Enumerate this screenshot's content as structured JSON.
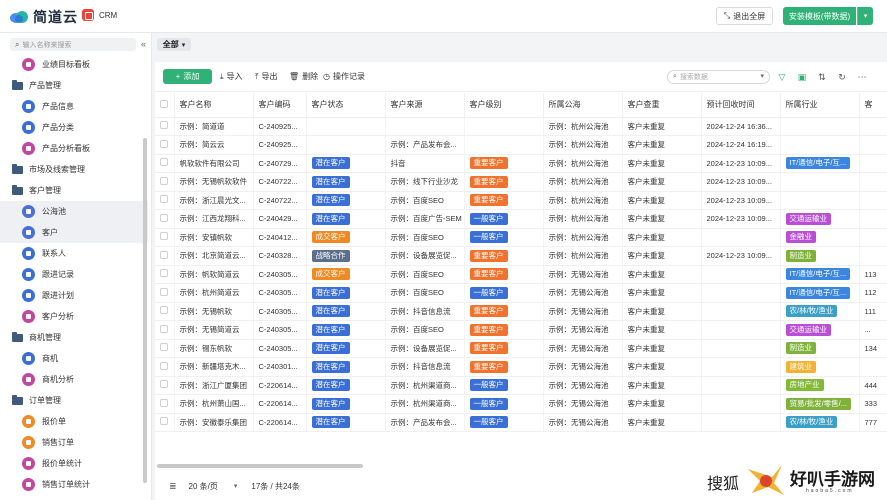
{
  "header": {
    "brand": "简道云",
    "app_name": "CRM",
    "exit_fullscreen": "退出全屏",
    "install_template": "安装模板(带数据)"
  },
  "sidebar": {
    "search_placeholder": "输入名称来搜索",
    "collapse": "«",
    "items": [
      {
        "type": "leaf",
        "label": "业绩目标看板",
        "icon": "dashboard-icon",
        "color": "#c1489e"
      },
      {
        "type": "group",
        "label": "产品管理"
      },
      {
        "type": "leaf",
        "label": "产品信息",
        "icon": "form-icon",
        "color": "#3b6fd6"
      },
      {
        "type": "leaf",
        "label": "产品分类",
        "icon": "form-icon",
        "color": "#3b6fd6"
      },
      {
        "type": "leaf",
        "label": "产品分析看板",
        "icon": "dashboard-icon",
        "color": "#c1489e"
      },
      {
        "type": "group",
        "label": "市场及线索管理"
      },
      {
        "type": "group",
        "label": "客户管理"
      },
      {
        "type": "leaf",
        "label": "公海池",
        "icon": "user-icon",
        "color": "#4a6fd8",
        "active": true
      },
      {
        "type": "leaf",
        "label": "客户",
        "icon": "user-icon",
        "color": "#4a6fd8",
        "active": true
      },
      {
        "type": "leaf",
        "label": "联系人",
        "icon": "form-icon",
        "color": "#3b6fd6"
      },
      {
        "type": "leaf",
        "label": "跟进记录",
        "icon": "form-icon",
        "color": "#3b6fd6"
      },
      {
        "type": "leaf",
        "label": "跟进计划",
        "icon": "form-icon",
        "color": "#3b6fd6"
      },
      {
        "type": "leaf",
        "label": "客户分析",
        "icon": "dashboard-icon",
        "color": "#c1489e"
      },
      {
        "type": "group",
        "label": "商机管理"
      },
      {
        "type": "leaf",
        "label": "商机",
        "icon": "opportunity-icon",
        "color": "#3b6fd6"
      },
      {
        "type": "leaf",
        "label": "商机分析",
        "icon": "dashboard-icon",
        "color": "#c1489e"
      },
      {
        "type": "group",
        "label": "订单管理"
      },
      {
        "type": "leaf",
        "label": "报价单",
        "icon": "quote-icon",
        "color": "#f08a24"
      },
      {
        "type": "leaf",
        "label": "销售订单",
        "icon": "order-icon",
        "color": "#f08a24"
      },
      {
        "type": "leaf",
        "label": "报价单统计",
        "icon": "dashboard-icon",
        "color": "#c1489e"
      },
      {
        "type": "leaf",
        "label": "销售订单统计",
        "icon": "dashboard-icon",
        "color": "#c1489e"
      }
    ]
  },
  "filter": {
    "label": "全部"
  },
  "toolbar": {
    "add": "添加",
    "import": "导入",
    "export": "导出",
    "delete": "删除",
    "op_log": "操作记录",
    "search_placeholder": "搜索数据"
  },
  "table": {
    "columns": [
      "客户名称",
      "客户编码",
      "客户状态",
      "客户来源",
      "客户级别",
      "所属公海",
      "客户查重",
      "预计回收时间",
      "所属行业",
      "客"
    ],
    "rows": [
      {
        "name": "示例：简道道",
        "code": "C-240925...",
        "status": "",
        "source": "",
        "level": "",
        "pool": "示例：杭州公海池",
        "dup": "客户未重复",
        "time": "2024-12-24 16:36...",
        "industry": "",
        "extra": ""
      },
      {
        "name": "示例：简云云",
        "code": "C-240925...",
        "status": "",
        "source": "示例：产品发布会...",
        "level": "",
        "pool": "示例：杭州公海池",
        "dup": "客户未重复",
        "time": "2024-12-24 16:19...",
        "industry": "",
        "extra": ""
      },
      {
        "name": "帆软软件有限公司",
        "code": "C-240729...",
        "status": "潜在客户",
        "source": "抖音",
        "level": "重要客户",
        "pool": "示例：杭州公海池",
        "dup": "客户未重复",
        "time": "2024-12-23 10:09...",
        "industry": "IT/通信/电子/互...",
        "extra": ""
      },
      {
        "name": "示例：无锡帆软软件",
        "code": "C-240722...",
        "status": "潜在客户",
        "source": "示例：线下行业沙龙",
        "level": "重要客户",
        "pool": "示例：杭州公海池",
        "dup": "客户未重复",
        "time": "2024-12-23 10:09...",
        "industry": "",
        "extra": ""
      },
      {
        "name": "示例：浙江晨光文...",
        "code": "C-240722...",
        "status": "潜在客户",
        "source": "示例：百度SEO",
        "level": "重要客户",
        "pool": "示例：杭州公海池",
        "dup": "客户未重复",
        "time": "2024-12-23 10:09...",
        "industry": "",
        "extra": ""
      },
      {
        "name": "示例：江西龙翔科...",
        "code": "C-240429...",
        "status": "潜在客户",
        "source": "示例：百度广告-SEM",
        "level": "一般客户",
        "pool": "示例：杭州公海池",
        "dup": "客户未重复",
        "time": "2024-12-23 10:09...",
        "industry": "交通运输业",
        "extra": ""
      },
      {
        "name": "示例：安镇帆软",
        "code": "C-240412...",
        "status": "成交客户",
        "source": "示例：百度SEO",
        "level": "一般客户",
        "pool": "示例：杭州公海池",
        "dup": "客户未重复",
        "time": "",
        "industry": "金融业",
        "extra": ""
      },
      {
        "name": "示例：北京简道云...",
        "code": "C-240328...",
        "status": "战略合作",
        "source": "示例：设备展览促...",
        "level": "重要客户",
        "pool": "示例：杭州公海池",
        "dup": "客户未重复",
        "time": "2024-12-23 10:09...",
        "industry": "制造业",
        "extra": ""
      },
      {
        "name": "示例：帆软简道云",
        "code": "C-240305...",
        "status": "成交客户",
        "source": "示例：百度SEO",
        "level": "重要客户",
        "pool": "示例：无锡公海池",
        "dup": "客户未重复",
        "time": "",
        "industry": "IT/通信/电子/互...",
        "extra": "113"
      },
      {
        "name": "示例：杭州简道云",
        "code": "C-240305...",
        "status": "潜在客户",
        "source": "示例：百度SEO",
        "level": "一般客户",
        "pool": "示例：无锡公海池",
        "dup": "客户未重复",
        "time": "",
        "industry": "IT/通信/电子/互...",
        "extra": "112"
      },
      {
        "name": "示例：无锡帆软",
        "code": "C-240305...",
        "status": "潜在客户",
        "source": "示例：抖音信息流",
        "level": "重要客户",
        "pool": "示例：无锡公海池",
        "dup": "客户未重复",
        "time": "",
        "industry": "农/林/牧/渔业",
        "extra": "111"
      },
      {
        "name": "示例：无锡简道云",
        "code": "C-240305...",
        "status": "潜在客户",
        "source": "示例：百度SEO",
        "level": "重要客户",
        "pool": "示例：无锡公海池",
        "dup": "客户未重复",
        "time": "",
        "industry": "交通运输业",
        "extra": "..."
      },
      {
        "name": "示例：锡东帆软",
        "code": "C-240305...",
        "status": "潜在客户",
        "source": "示例：设备展览促...",
        "level": "重要客户",
        "pool": "示例：无锡公海池",
        "dup": "客户未重复",
        "time": "",
        "industry": "制造业",
        "extra": "134"
      },
      {
        "name": "示例：新疆塔克木...",
        "code": "C-240301...",
        "status": "潜在客户",
        "source": "示例：抖音信息流",
        "level": "重要客户",
        "pool": "示例：无锡公海池",
        "dup": "客户未重复",
        "time": "",
        "industry": "建筑业",
        "extra": ""
      },
      {
        "name": "示例：浙江广厦集团",
        "code": "C-220614...",
        "status": "潜在客户",
        "source": "示例：杭州渠道商...",
        "level": "一般客户",
        "pool": "示例：无锡公海池",
        "dup": "客户未重复",
        "time": "",
        "industry": "房地产业",
        "extra": "444"
      },
      {
        "name": "示例：杭州萧山国...",
        "code": "C-220614...",
        "status": "潜在客户",
        "source": "示例：杭州渠道商...",
        "level": "一般客户",
        "pool": "示例：无锡公海池",
        "dup": "客户未重复",
        "time": "",
        "industry": "贸易/批发/零售/...",
        "extra": "333"
      },
      {
        "name": "示例：安徽泰乐集团",
        "code": "C-220614...",
        "status": "潜在客户",
        "source": "示例：产品发布会...",
        "level": "一般客户",
        "pool": "示例：无锡公海池",
        "dup": "客户未重复",
        "time": "",
        "industry": "农/林/牧/渔业",
        "extra": "777"
      }
    ]
  },
  "tag_colors": {
    "潜在客户": "#3a6fd8",
    "成交客户": "#f08a24",
    "战略合作": "#5b6f8c",
    "重要客户": "#f0722c",
    "一般客户": "#3a6fd8",
    "IT/通信/电子/互...": "#3a86e0",
    "交通运输业": "#b84fd4",
    "金融业": "#b84fd4",
    "制造业": "#7fb23a",
    "农/林/牧/渔业": "#3aa0c8",
    "建筑业": "#f2b233",
    "房地产业": "#82b935",
    "贸易/批发/零售/...": "#7fb23a"
  },
  "pager": {
    "page_size": "20 条/页",
    "total": "17条 / 共24条"
  },
  "watermark": {
    "search": "搜狐",
    "brand": "好叭手游网",
    "sub": "haoba5.com"
  }
}
